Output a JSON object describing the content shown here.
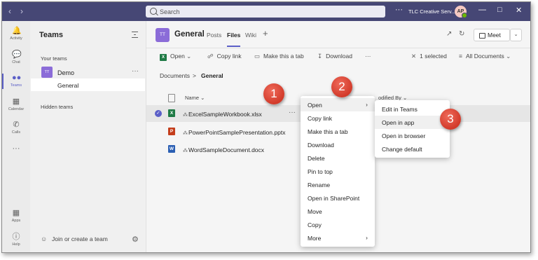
{
  "topbar": {
    "search_placeholder": "Search",
    "more": "···",
    "org_name": "TLC Creative Serv...",
    "avatar_initials": "AP"
  },
  "rail": [
    {
      "label": "Activity",
      "icon": "bell-icon"
    },
    {
      "label": "Chat",
      "icon": "chat-icon"
    },
    {
      "label": "Teams",
      "icon": "teams-icon"
    },
    {
      "label": "Calendar",
      "icon": "calendar-icon"
    },
    {
      "label": "Calls",
      "icon": "phone-icon"
    },
    {
      "label": "",
      "icon": "more-icon"
    },
    {
      "label": "Apps",
      "icon": "apps-icon"
    },
    {
      "label": "Help",
      "icon": "help-icon"
    }
  ],
  "teams_panel": {
    "title": "Teams",
    "your_teams_label": "Your teams",
    "team_initials": "TT",
    "team_name": "Demo",
    "team_more": "···",
    "channel_name": "General",
    "hidden_teams_label": "Hidden teams",
    "join_label": "Join or create a team"
  },
  "channel": {
    "initials": "TT",
    "name": "General",
    "tabs": [
      "Posts",
      "Files",
      "Wiki"
    ],
    "active_tab": "Files",
    "meet_label": "Meet"
  },
  "toolbar": {
    "open": "Open",
    "copy_link": "Copy link",
    "make_tab": "Make this a tab",
    "download": "Download",
    "more": "···",
    "selected": "1 selected",
    "all_documents": "All Documents"
  },
  "breadcrumb": {
    "root": "Documents",
    "separator": ">",
    "current": "General"
  },
  "file_list": {
    "col_name": "Name",
    "col_modified_by": "odified By",
    "files": [
      {
        "name": "ExcelSampleWorkbook.xlsx",
        "type": "excel",
        "badge": "X",
        "color": "#1f7a45",
        "selected": true
      },
      {
        "name": "PowerPointSamplePresentation.pptx",
        "type": "powerpoint",
        "badge": "P",
        "color": "#c43e1c",
        "selected": false
      },
      {
        "name": "WordSampleDocument.docx",
        "type": "word",
        "badge": "W",
        "color": "#2b5fb3",
        "selected": false
      }
    ],
    "row_more": "···"
  },
  "context_menu": {
    "items": [
      "Open",
      "Copy link",
      "Make this a tab",
      "Download",
      "Delete",
      "Pin to top",
      "Rename",
      "Open in SharePoint",
      "Move",
      "Copy",
      "More"
    ],
    "highlighted": "Open"
  },
  "submenu": {
    "items": [
      "Edit in Teams",
      "Open in app",
      "Open in browser",
      "Change default"
    ],
    "highlighted": "Open in app"
  },
  "callouts": [
    "1",
    "2",
    "3"
  ],
  "colors": {
    "topbar": "#464775",
    "accent": "#5b5fc7",
    "callout": "#d23a2a"
  }
}
